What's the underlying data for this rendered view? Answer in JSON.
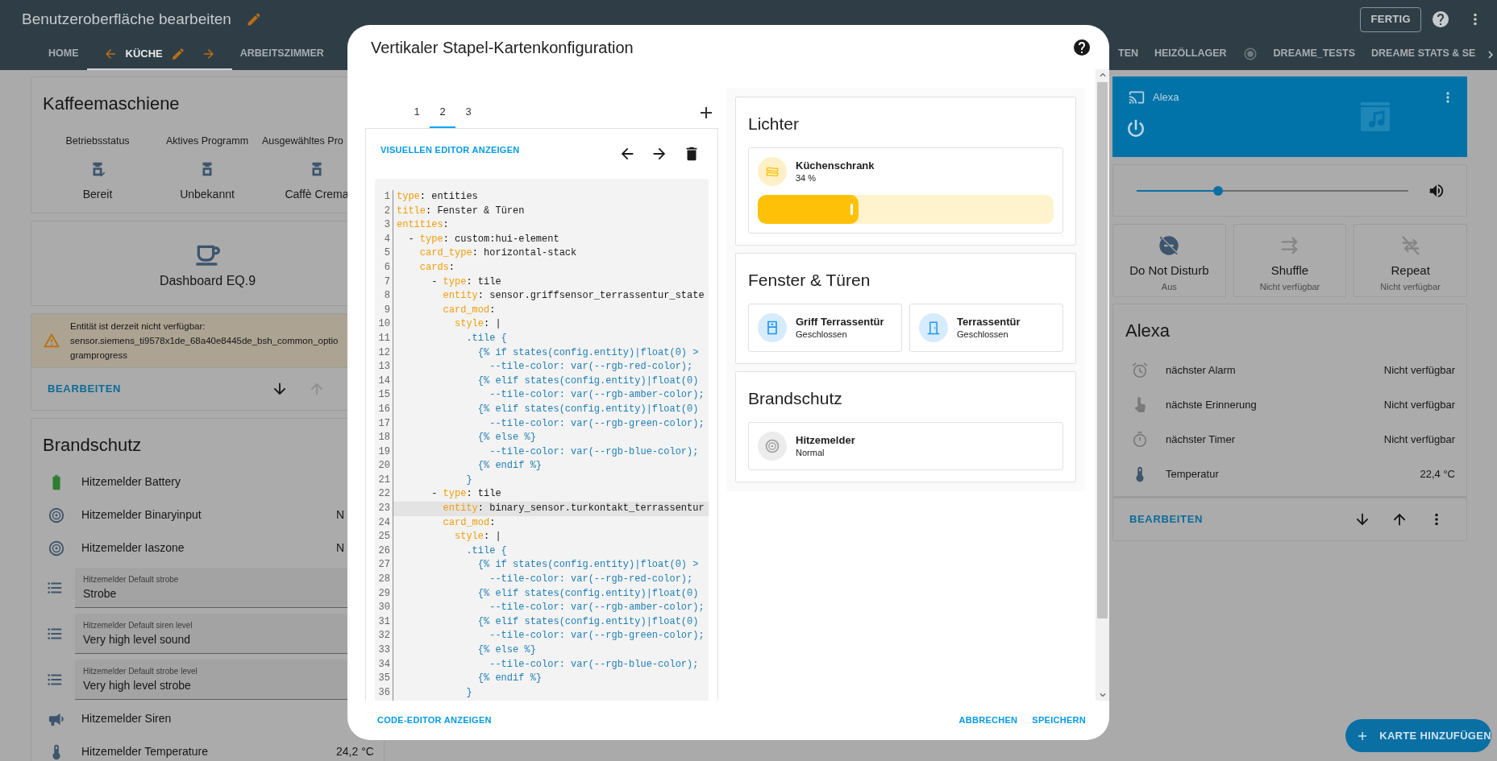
{
  "header": {
    "title": "Benutzeroberfläche bearbeiten",
    "done_button": "FERTIG"
  },
  "view_tabs": [
    {
      "kind": "text",
      "label": "HOME",
      "selected": false
    },
    {
      "kind": "movable",
      "label": "KÜCHE",
      "selected": true
    },
    {
      "kind": "text",
      "label": "ARBEITSZIMMER",
      "selected": false
    }
  ],
  "view_tabs_right": [
    {
      "kind": "text",
      "label": "TEN",
      "selected": false
    },
    {
      "kind": "text",
      "label": "HEIZÖLLAGER",
      "selected": false
    },
    {
      "kind": "icon",
      "selected": false
    },
    {
      "kind": "text",
      "label": "DREAME_TESTS",
      "selected": false
    },
    {
      "kind": "text",
      "label": "DREAME STATS & SE",
      "selected": false
    }
  ],
  "left_column": [
    {
      "kind": "glance",
      "title": "Kaffeemaschiene",
      "items": [
        {
          "kind": "ready",
          "label": "Betriebsstatus",
          "value": "Bereit"
        },
        {
          "kind": "machine",
          "label": "Aktives Programm",
          "value": "Unbekannt"
        },
        {
          "kind": "machine",
          "label": "Ausgewähltes Pro",
          "value": "Caffè Crema"
        }
      ]
    },
    {
      "kind": "button",
      "name": "Dashboard EQ.9"
    },
    {
      "kind": "warning",
      "lines": [
        "Entität ist derzeit nicht verfügbar:",
        "sensor.siemens_ti9578x1de_68a40e8445de_bsh_common_optio",
        "gramprogress"
      ],
      "footer": {
        "edit_label": "BEARBEITEN",
        "actions": [
          {
            "kind": "down",
            "disabled": false
          },
          {
            "kind": "up",
            "disabled": true
          }
        ]
      }
    },
    {
      "kind": "entities",
      "title": "Brandschutz",
      "rows": [
        {
          "kind": "battery",
          "name": "Hitzemelder Battery"
        },
        {
          "kind": "detector",
          "name": "Hitzemelder Binaryinput",
          "value": "N"
        },
        {
          "kind": "detector",
          "name": "Hitzemelder Iaszone",
          "value": "N"
        },
        {
          "kind": "select",
          "label": "Hitzemelder Default strobe",
          "value": "Strobe"
        },
        {
          "kind": "select",
          "label": "Hitzemelder Default siren level",
          "value": "Very high level sound"
        },
        {
          "kind": "select",
          "label": "Hitzemelder Default strobe level",
          "value": "Very high level strobe"
        },
        {
          "kind": "siren",
          "name": "Hitzemelder Siren"
        },
        {
          "kind": "temperature",
          "name": "Hitzemelder Temperature",
          "value": "24,2 °C"
        }
      ]
    }
  ],
  "right_column": {
    "media": {
      "name": "Alexa"
    },
    "volume": {
      "level": 0.3
    },
    "toggles": [
      {
        "kind": "dnd",
        "name": "Do Not Disturb",
        "state": "Aus",
        "available": true
      },
      {
        "kind": "shuffle",
        "name": "Shuffle",
        "state": "Nicht verfügbar",
        "available": false
      },
      {
        "kind": "repeat",
        "name": "Repeat",
        "state": "Nicht verfügbar",
        "available": false
      }
    ],
    "entities_card": {
      "title": "Alexa",
      "rows": [
        {
          "kind": "alarm",
          "name": "nächster Alarm",
          "value": "Nicht verfügbar"
        },
        {
          "kind": "reminder",
          "name": "nächste Erinnerung",
          "value": "Nicht verfügbar"
        },
        {
          "kind": "timer",
          "name": "nächster Timer",
          "value": "Nicht verfügbar"
        },
        {
          "kind": "temperature",
          "name": "Temperatur",
          "value": "22,4 °C"
        }
      ],
      "footer": {
        "edit_label": "BEARBEITEN",
        "actions": [
          {
            "kind": "down",
            "disabled": false
          },
          {
            "kind": "up",
            "disabled": false
          },
          {
            "kind": "menu",
            "disabled": false
          }
        ]
      }
    }
  },
  "add_card_button": "KARTE HINZUFÜGEN",
  "dialog": {
    "title": "Vertikaler Stapel-Kartenkonfiguration",
    "stack_tabs": [
      {
        "label": "1",
        "selected": false
      },
      {
        "label": "2",
        "selected": true
      },
      {
        "label": "3",
        "selected": false
      }
    ],
    "editor_toggle": "VISUELLEN EDITOR ANZEIGEN",
    "code_lines": [
      {
        "number": "1",
        "active": false,
        "parts": [
          {
            "kind": "key",
            "text": "type"
          },
          {
            "kind": "plain",
            "text": ": entities"
          }
        ]
      },
      {
        "number": "2",
        "active": false,
        "parts": [
          {
            "kind": "key",
            "text": "title"
          },
          {
            "kind": "plain",
            "text": ": Fenster & Türen"
          }
        ]
      },
      {
        "number": "3",
        "active": false,
        "parts": [
          {
            "kind": "key",
            "text": "entities"
          },
          {
            "kind": "plain",
            "text": ":"
          }
        ]
      },
      {
        "number": "4",
        "active": false,
        "parts": [
          {
            "kind": "plain",
            "text": "  - "
          },
          {
            "kind": "key",
            "text": "type"
          },
          {
            "kind": "plain",
            "text": ": custom:hui-element"
          }
        ]
      },
      {
        "number": "5",
        "active": false,
        "parts": [
          {
            "kind": "key",
            "text": "    card_type"
          },
          {
            "kind": "plain",
            "text": ": horizontal-stack"
          }
        ]
      },
      {
        "number": "6",
        "active": false,
        "parts": [
          {
            "kind": "key",
            "text": "    cards"
          },
          {
            "kind": "plain",
            "text": ":"
          }
        ]
      },
      {
        "number": "7",
        "active": false,
        "parts": [
          {
            "kind": "plain",
            "text": "      - "
          },
          {
            "kind": "key",
            "text": "type"
          },
          {
            "kind": "plain",
            "text": ": tile"
          }
        ]
      },
      {
        "number": "8",
        "active": false,
        "parts": [
          {
            "kind": "key",
            "text": "        entity"
          },
          {
            "kind": "plain",
            "text": ": sensor.griffsensor_terrassentur_state"
          }
        ]
      },
      {
        "number": "9",
        "active": false,
        "parts": [
          {
            "kind": "key",
            "text": "        card_mod"
          },
          {
            "kind": "plain",
            "text": ":"
          }
        ]
      },
      {
        "number": "10",
        "active": false,
        "parts": [
          {
            "kind": "key",
            "text": "          style"
          },
          {
            "kind": "plain",
            "text": ": |"
          }
        ]
      },
      {
        "number": "11",
        "active": false,
        "parts": [
          {
            "kind": "template",
            "text": "            .tile {"
          }
        ]
      },
      {
        "number": "12",
        "active": false,
        "parts": [
          {
            "kind": "template",
            "text": "              {% if states(config.entity)|float(0) >"
          }
        ]
      },
      {
        "number": "13",
        "active": false,
        "parts": [
          {
            "kind": "template",
            "text": "                --tile-color: var(--rgb-red-color);"
          }
        ]
      },
      {
        "number": "14",
        "active": false,
        "parts": [
          {
            "kind": "template",
            "text": "              {% elif states(config.entity)|float(0)"
          }
        ]
      },
      {
        "number": "15",
        "active": false,
        "parts": [
          {
            "kind": "template",
            "text": "                --tile-color: var(--rgb-amber-color);"
          }
        ]
      },
      {
        "number": "16",
        "active": false,
        "parts": [
          {
            "kind": "template",
            "text": "              {% elif states(config.entity)|float(0)"
          }
        ]
      },
      {
        "number": "17",
        "active": false,
        "parts": [
          {
            "kind": "template",
            "text": "                --tile-color: var(--rgb-green-color);"
          }
        ]
      },
      {
        "number": "18",
        "active": false,
        "parts": [
          {
            "kind": "template",
            "text": "              {% else %}"
          }
        ]
      },
      {
        "number": "19",
        "active": false,
        "parts": [
          {
            "kind": "template",
            "text": "                --tile-color: var(--rgb-blue-color);"
          }
        ]
      },
      {
        "number": "20",
        "active": false,
        "parts": [
          {
            "kind": "template",
            "text": "              {% endif %}"
          }
        ]
      },
      {
        "number": "21",
        "active": false,
        "parts": [
          {
            "kind": "template",
            "text": "            }"
          }
        ]
      },
      {
        "number": "22",
        "active": false,
        "parts": [
          {
            "kind": "plain",
            "text": "      - "
          },
          {
            "kind": "key",
            "text": "type"
          },
          {
            "kind": "plain",
            "text": ": tile"
          }
        ]
      },
      {
        "number": "23",
        "active": true,
        "parts": [
          {
            "kind": "key",
            "text": "        entity"
          },
          {
            "kind": "plain",
            "text": ": binary_sensor.turkontakt_terrassentur"
          }
        ]
      },
      {
        "number": "24",
        "active": false,
        "parts": [
          {
            "kind": "key",
            "text": "        card_mod"
          },
          {
            "kind": "plain",
            "text": ":"
          }
        ]
      },
      {
        "number": "25",
        "active": false,
        "parts": [
          {
            "kind": "key",
            "text": "          style"
          },
          {
            "kind": "plain",
            "text": ": |"
          }
        ]
      },
      {
        "number": "26",
        "active": false,
        "parts": [
          {
            "kind": "template",
            "text": "            .tile {"
          }
        ]
      },
      {
        "number": "27",
        "active": false,
        "parts": [
          {
            "kind": "template",
            "text": "              {% if states(config.entity)|float(0) >"
          }
        ]
      },
      {
        "number": "28",
        "active": false,
        "parts": [
          {
            "kind": "template",
            "text": "                --tile-color: var(--rgb-red-color);"
          }
        ]
      },
      {
        "number": "29",
        "active": false,
        "parts": [
          {
            "kind": "template",
            "text": "              {% elif states(config.entity)|float(0)"
          }
        ]
      },
      {
        "number": "30",
        "active": false,
        "parts": [
          {
            "kind": "template",
            "text": "                --tile-color: var(--rgb-amber-color);"
          }
        ]
      },
      {
        "number": "31",
        "active": false,
        "parts": [
          {
            "kind": "template",
            "text": "              {% elif states(config.entity)|float(0)"
          }
        ]
      },
      {
        "number": "32",
        "active": false,
        "parts": [
          {
            "kind": "template",
            "text": "                --tile-color: var(--rgb-green-color);"
          }
        ]
      },
      {
        "number": "33",
        "active": false,
        "parts": [
          {
            "kind": "template",
            "text": "              {% else %}"
          }
        ]
      },
      {
        "number": "34",
        "active": false,
        "parts": [
          {
            "kind": "template",
            "text": "                --tile-color: var(--rgb-blue-color);"
          }
        ]
      },
      {
        "number": "35",
        "active": false,
        "parts": [
          {
            "kind": "template",
            "text": "              {% endif %}"
          }
        ]
      },
      {
        "number": "36",
        "active": false,
        "parts": [
          {
            "kind": "template",
            "text": "            }"
          }
        ]
      }
    ],
    "preview": [
      {
        "title": "Lichter",
        "tiles": [
          {
            "kind": "light",
            "name": "Küchenschrank",
            "state": "34 %",
            "level": 0.34
          }
        ]
      },
      {
        "title": "Fenster & Türen",
        "tiles": [
          {
            "kind": "window",
            "name": "Griff Terrassentür",
            "state": "Geschlossen"
          },
          {
            "kind": "door",
            "name": "Terrassentür",
            "state": "Geschlossen"
          }
        ]
      },
      {
        "title": "Brandschutz",
        "tiles": [
          {
            "kind": "detector",
            "name": "Hitzemelder",
            "state": "Normal"
          }
        ]
      }
    ],
    "footer": {
      "code_editor": "CODE-EDITOR ANZEIGEN",
      "cancel": "ABBRECHEN",
      "save": "SPEICHERN"
    }
  }
}
